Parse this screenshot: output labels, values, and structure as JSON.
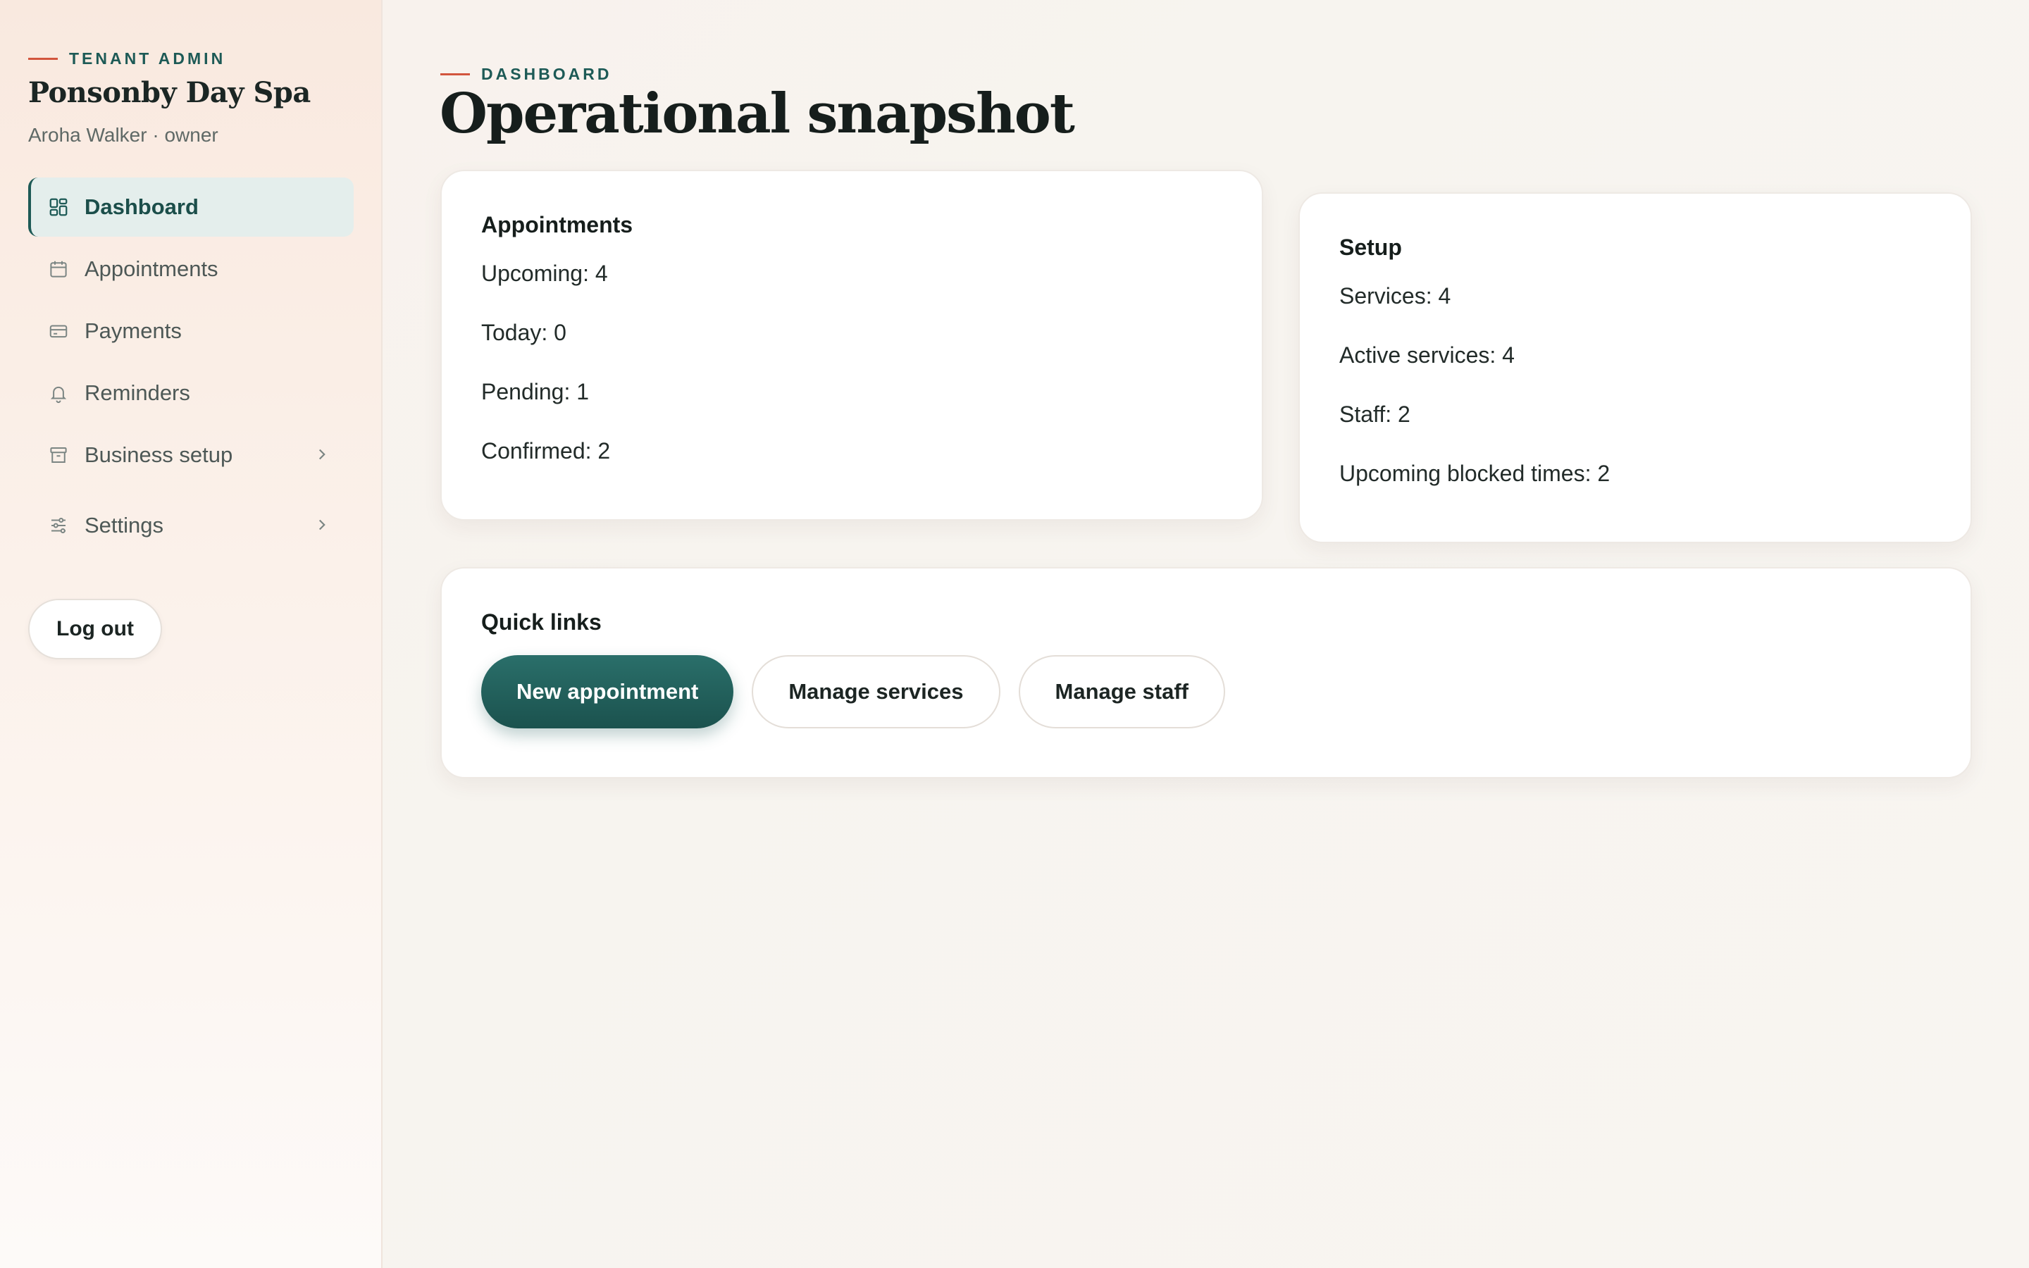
{
  "sidebar": {
    "eyebrow": "TENANT ADMIN",
    "business_name": "Ponsonby Day Spa",
    "user_line": "Aroha Walker · owner",
    "nav": [
      {
        "label": "Dashboard",
        "icon": "dashboard-icon",
        "active": true
      },
      {
        "label": "Appointments",
        "icon": "calendar-icon"
      },
      {
        "label": "Payments",
        "icon": "credit-card-icon"
      },
      {
        "label": "Reminders",
        "icon": "bell-icon"
      },
      {
        "label": "Business setup",
        "icon": "store-icon",
        "has_submenu": true
      },
      {
        "label": "Settings",
        "icon": "sliders-icon",
        "has_submenu": true
      }
    ],
    "logout_label": "Log out"
  },
  "header": {
    "eyebrow": "DASHBOARD",
    "title": "Operational snapshot"
  },
  "appointments": {
    "title": "Appointments",
    "stats": [
      "Upcoming: 4",
      "Today: 0",
      "Pending: 1",
      "Confirmed: 2"
    ]
  },
  "setup": {
    "title": "Setup",
    "stats": [
      "Services: 4",
      "Active services: 4",
      "Staff: 2",
      "Upcoming blocked times: 2"
    ]
  },
  "quick_links": {
    "title": "Quick links",
    "new_appointment": "New appointment",
    "manage_services": "Manage services",
    "manage_staff": "Manage staff"
  },
  "colors": {
    "accent": "#1d5a56",
    "accent_dash": "#d2553d",
    "active_nav_bg": "#e4eeec"
  }
}
